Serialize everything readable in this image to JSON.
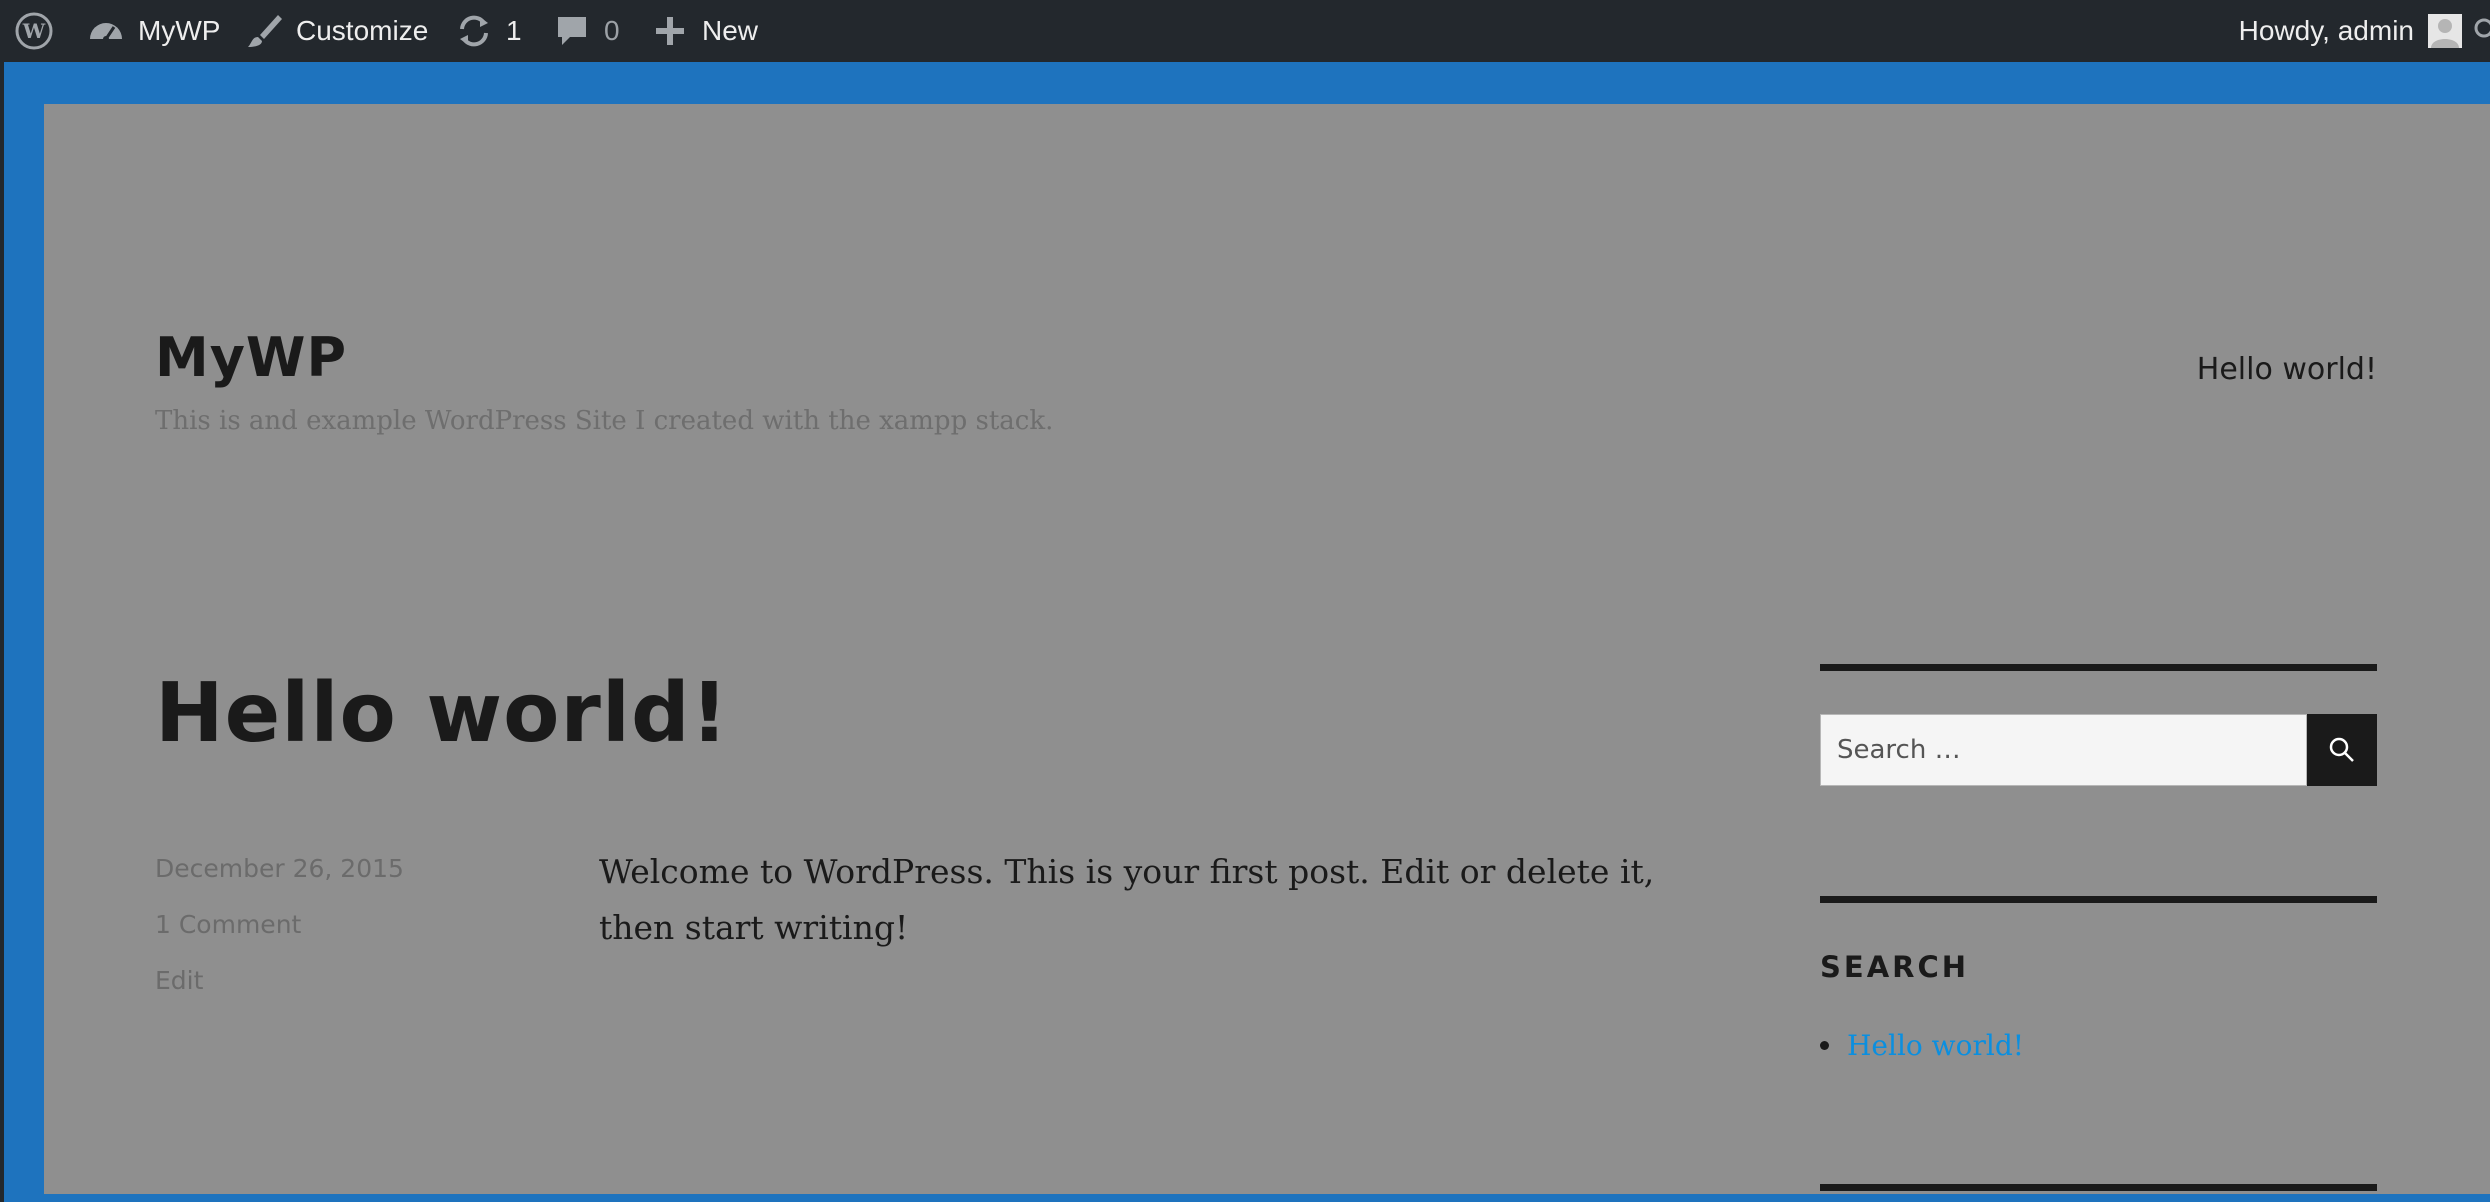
{
  "admin_bar": {
    "site_name": "MyWP",
    "customize_label": "Customize",
    "updates_count": "1",
    "comments_count": "0",
    "new_label": "New",
    "greeting": "Howdy, admin"
  },
  "site": {
    "title": "MyWP",
    "description": "This is and example WordPress Site I created with the xampp stack.",
    "nav": [
      "Hello world!"
    ]
  },
  "post": {
    "title": "Hello world!",
    "date": "December 26, 2015",
    "comments": "1 Comment",
    "edit": "Edit",
    "content": "Welcome to WordPress. This is your first post. Edit or delete it, then start writing!"
  },
  "sidebar": {
    "search_placeholder": "Search …",
    "widget_title": "SEARCH",
    "widget_items": [
      "Hello world!"
    ]
  },
  "colors": {
    "admin_bar_bg": "#23282d",
    "customizer_blue": "#1e73be",
    "page_bg_dimmed": "#8f8f8f",
    "link": "#0a8fe0",
    "text": "#1a1a1a"
  },
  "icons": [
    "wordpress-logo-icon",
    "dashboard-icon",
    "brush-icon",
    "updates-icon",
    "comment-icon",
    "plus-icon",
    "avatar-icon",
    "search-icon"
  ]
}
